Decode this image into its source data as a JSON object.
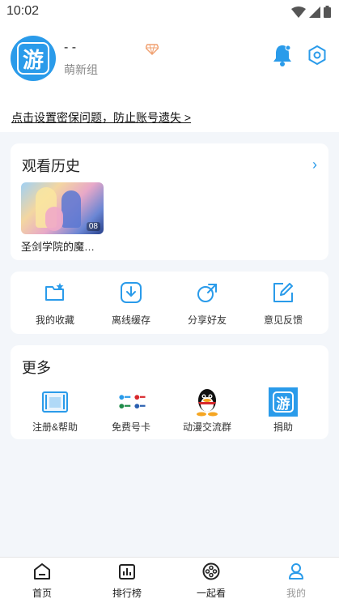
{
  "status_bar": {
    "time": "10:02"
  },
  "profile": {
    "avatar_char": "游",
    "username": "- -",
    "group": "萌新组"
  },
  "notice": {
    "text": "点击设置密保问题，防止账号遗失 >"
  },
  "history": {
    "title": "观看历史",
    "items": [
      {
        "title": "圣剑学院的魔…",
        "episode": "08"
      }
    ]
  },
  "actions": [
    {
      "label": "我的收藏",
      "icon": "favorites-folder-icon"
    },
    {
      "label": "离线缓存",
      "icon": "download-icon"
    },
    {
      "label": "分享好友",
      "icon": "share-icon"
    },
    {
      "label": "意见反馈",
      "icon": "feedback-edit-icon"
    }
  ],
  "more": {
    "title": "更多",
    "items": [
      {
        "label": "注册&帮助",
        "icon": "help-book-icon"
      },
      {
        "label": "免费号卡",
        "icon": "carrier-logos-icon"
      },
      {
        "label": "动漫交流群",
        "icon": "qq-penguin-icon"
      },
      {
        "label": "捐助",
        "icon": "donate-logo-icon",
        "char": "游"
      }
    ]
  },
  "nav": [
    {
      "label": "首页",
      "icon": "home-icon"
    },
    {
      "label": "排行榜",
      "icon": "ranking-icon"
    },
    {
      "label": "一起看",
      "icon": "watch-together-icon"
    },
    {
      "label": "我的",
      "icon": "profile-icon",
      "active": true
    }
  ],
  "colors": {
    "accent": "#2a9bea",
    "background": "#f3f6fa",
    "card": "#ffffff"
  }
}
